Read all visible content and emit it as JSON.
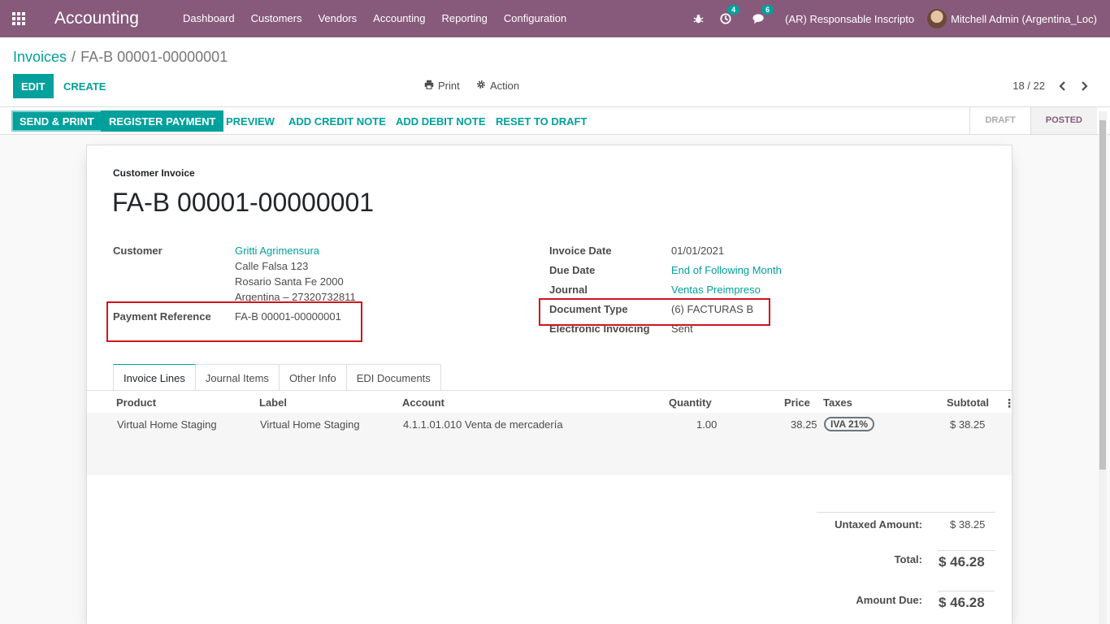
{
  "navbar": {
    "brand": "Accounting",
    "menu": [
      "Dashboard",
      "Customers",
      "Vendors",
      "Accounting",
      "Reporting",
      "Configuration"
    ],
    "activity_badge": "4",
    "messages_badge": "6",
    "company": "(AR) Responsable Inscripto",
    "user": "Mitchell Admin (Argentina_Loc)"
  },
  "breadcrumb": {
    "parent": "Invoices",
    "separator": "/",
    "current": "FA-B 00001-00000001"
  },
  "control": {
    "edit": "EDIT",
    "create": "CREATE",
    "print": "Print",
    "action": "Action",
    "pager": "18 / 22"
  },
  "statusbar": {
    "buttons": [
      "SEND & PRINT",
      "REGISTER PAYMENT",
      "PREVIEW",
      "ADD CREDIT NOTE",
      "ADD DEBIT NOTE",
      "RESET TO DRAFT"
    ],
    "states": [
      "DRAFT",
      "POSTED"
    ]
  },
  "invoice": {
    "subtitle": "Customer Invoice",
    "title": "FA-B 00001-00000001",
    "customer_label": "Customer",
    "customer_name": "Gritti Agrimensura",
    "customer_address": [
      "Calle Falsa 123",
      "Rosario Santa Fe 2000",
      "Argentina – 27320732811"
    ],
    "payment_ref_label": "Payment Reference",
    "payment_ref": "FA-B 00001-00000001",
    "invoice_date_label": "Invoice Date",
    "invoice_date": "01/01/2021",
    "due_date_label": "Due Date",
    "due_date": "End of Following Month",
    "journal_label": "Journal",
    "journal": "Ventas Preimpreso",
    "doc_type_label": "Document Type",
    "doc_type": "(6) FACTURAS B",
    "einv_label": "Electronic Invoicing",
    "einv": "Sent"
  },
  "tabs": [
    "Invoice Lines",
    "Journal Items",
    "Other Info",
    "EDI Documents"
  ],
  "lines": {
    "headers": [
      "Product",
      "Label",
      "Account",
      "Quantity",
      "Price",
      "Taxes",
      "Subtotal"
    ],
    "rows": [
      {
        "product": "Virtual Home Staging",
        "label": "Virtual Home Staging",
        "account": "4.1.1.01.010 Venta de mercadería",
        "quantity": "1.00",
        "price": "38.25",
        "tax": "IVA 21%",
        "subtotal": "$ 38.25"
      }
    ]
  },
  "totals": {
    "untaxed_label": "Untaxed Amount:",
    "untaxed": "$ 38.25",
    "total_label": "Total:",
    "total": "$ 46.28",
    "due_label": "Amount Due:",
    "due": "$ 46.28"
  },
  "colors": {
    "brand": "#875a7b",
    "accent": "#00a09d",
    "highlight": "#d0151c"
  }
}
